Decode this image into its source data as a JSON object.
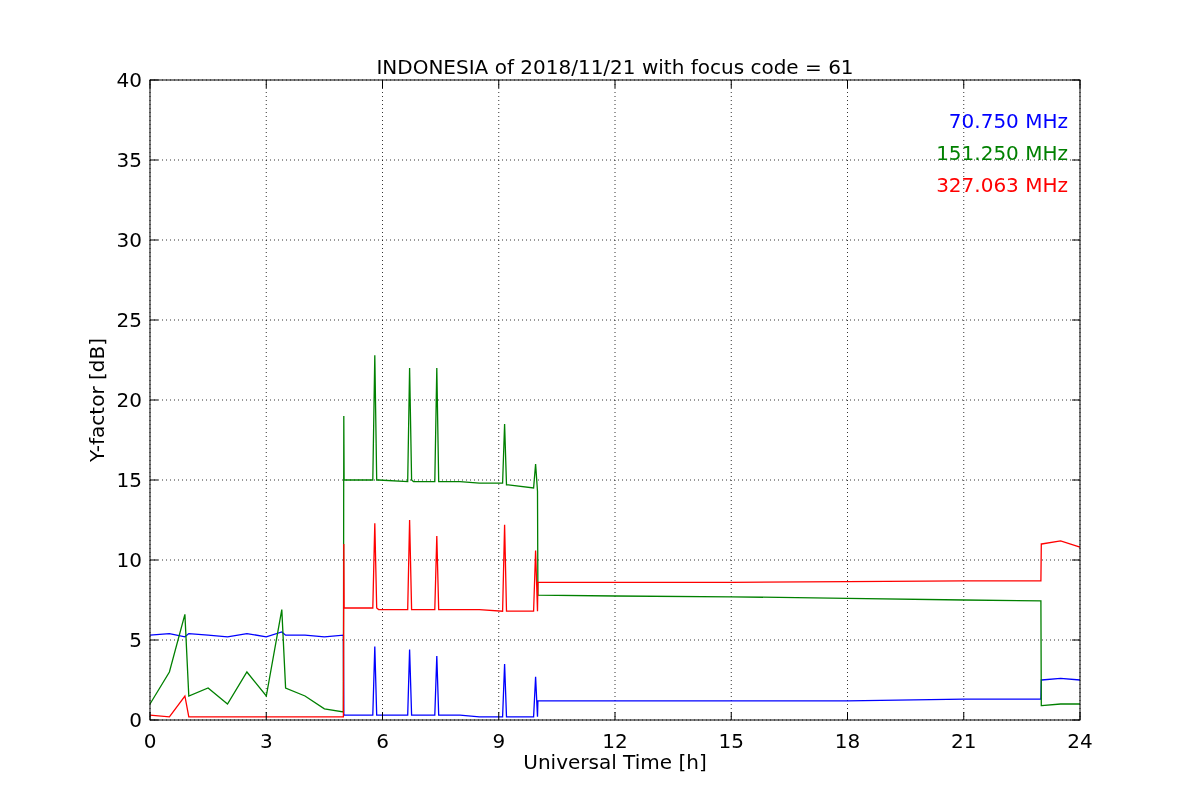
{
  "chart_data": {
    "type": "line",
    "title": "INDONESIA of 2018/11/21 with focus code = 61",
    "xlabel": "Universal Time [h]",
    "ylabel": "Y-factor [dB]",
    "x": [
      0,
      0.5,
      0.9,
      1,
      1.5,
      2,
      2.5,
      3,
      3.4,
      3.5,
      4,
      4.5,
      4.99,
      5,
      5.01,
      5.75,
      5.8,
      5.85,
      5.9,
      6.65,
      6.7,
      6.75,
      6.8,
      7.35,
      7.4,
      7.45,
      7.5,
      8,
      8.5,
      9.1,
      9.15,
      9.2,
      9.25,
      9.9,
      9.95,
      10,
      10.01,
      12,
      15,
      18,
      21,
      22.99,
      23,
      23.01,
      23.5,
      24
    ],
    "series": [
      {
        "name": "70.750 MHz",
        "color": "#0000ff",
        "values": [
          5.3,
          5.4,
          5.2,
          5.4,
          5.3,
          5.2,
          5.4,
          5.2,
          5.5,
          5.3,
          5.3,
          5.2,
          5.3,
          0.4,
          0.3,
          0.3,
          4.6,
          0.3,
          0.3,
          0.3,
          4.4,
          0.3,
          0.3,
          0.3,
          4.0,
          0.3,
          0.3,
          0.3,
          0.2,
          0.2,
          3.5,
          0.2,
          0.2,
          0.2,
          2.7,
          0.2,
          1.2,
          1.2,
          1.2,
          1.2,
          1.3,
          1.3,
          2.5,
          2.5,
          2.6,
          2.5
        ]
      },
      {
        "name": "151.250 MHz",
        "color": "#008000",
        "values": [
          1.0,
          3.0,
          6.6,
          1.5,
          2.0,
          1.0,
          3.0,
          1.5,
          6.9,
          2.0,
          1.5,
          0.7,
          0.5,
          19.0,
          15.0,
          15.0,
          22.8,
          15.0,
          15.0,
          14.9,
          22.0,
          15.0,
          14.9,
          14.9,
          22.0,
          14.9,
          14.9,
          14.9,
          14.8,
          14.8,
          18.5,
          14.7,
          14.7,
          14.5,
          16.0,
          14.3,
          7.8,
          7.75,
          7.7,
          7.6,
          7.5,
          7.45,
          0.9,
          0.9,
          1.0,
          1.0
        ]
      },
      {
        "name": "327.063 MHz",
        "color": "#ff0000",
        "values": [
          0.3,
          0.2,
          1.5,
          0.2,
          0.2,
          0.2,
          0.2,
          0.2,
          0.2,
          0.2,
          0.2,
          0.2,
          0.2,
          11.0,
          7.0,
          7.0,
          12.3,
          7.0,
          6.9,
          6.9,
          12.5,
          6.9,
          6.9,
          6.9,
          11.5,
          6.9,
          6.9,
          6.9,
          6.9,
          6.8,
          12.2,
          6.8,
          6.8,
          6.8,
          10.6,
          6.8,
          8.6,
          8.6,
          8.6,
          8.65,
          8.7,
          8.7,
          11.0,
          11.0,
          11.2,
          10.8
        ]
      }
    ],
    "xlim": [
      0,
      24
    ],
    "ylim": [
      0,
      40
    ],
    "xticks": [
      0,
      3,
      6,
      9,
      12,
      15,
      18,
      21,
      24
    ],
    "yticks": [
      0,
      5,
      10,
      15,
      20,
      25,
      30,
      35,
      40
    ],
    "grid": true
  }
}
